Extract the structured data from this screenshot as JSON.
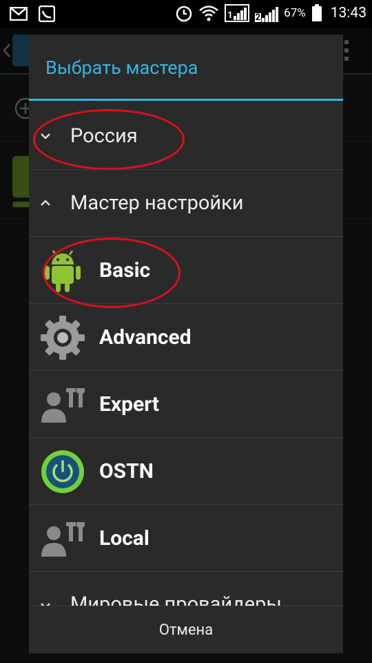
{
  "status_bar": {
    "battery_percent": "67%",
    "time": "13:43",
    "sim1": "1",
    "sim2": "2"
  },
  "dialog": {
    "title": "Выбрать мастера",
    "groups": [
      {
        "label": "Россия",
        "expanded": false
      },
      {
        "label": "Мастер настройки",
        "expanded": true
      }
    ],
    "items": [
      {
        "label": "Basic",
        "icon": "android-icon"
      },
      {
        "label": "Advanced",
        "icon": "gear-icon"
      },
      {
        "label": "Expert",
        "icon": "user-tools-icon"
      },
      {
        "label": "OSTN",
        "icon": "power-icon"
      },
      {
        "label": "Local",
        "icon": "user-tools-icon"
      }
    ],
    "partial_group": {
      "label": "Мировые провайдеры",
      "expanded": false
    },
    "cancel_label": "Отмена"
  },
  "colors": {
    "accent": "#33b5e5",
    "annotation": "#d8121d",
    "dialog_bg": "#2a2a2a"
  }
}
